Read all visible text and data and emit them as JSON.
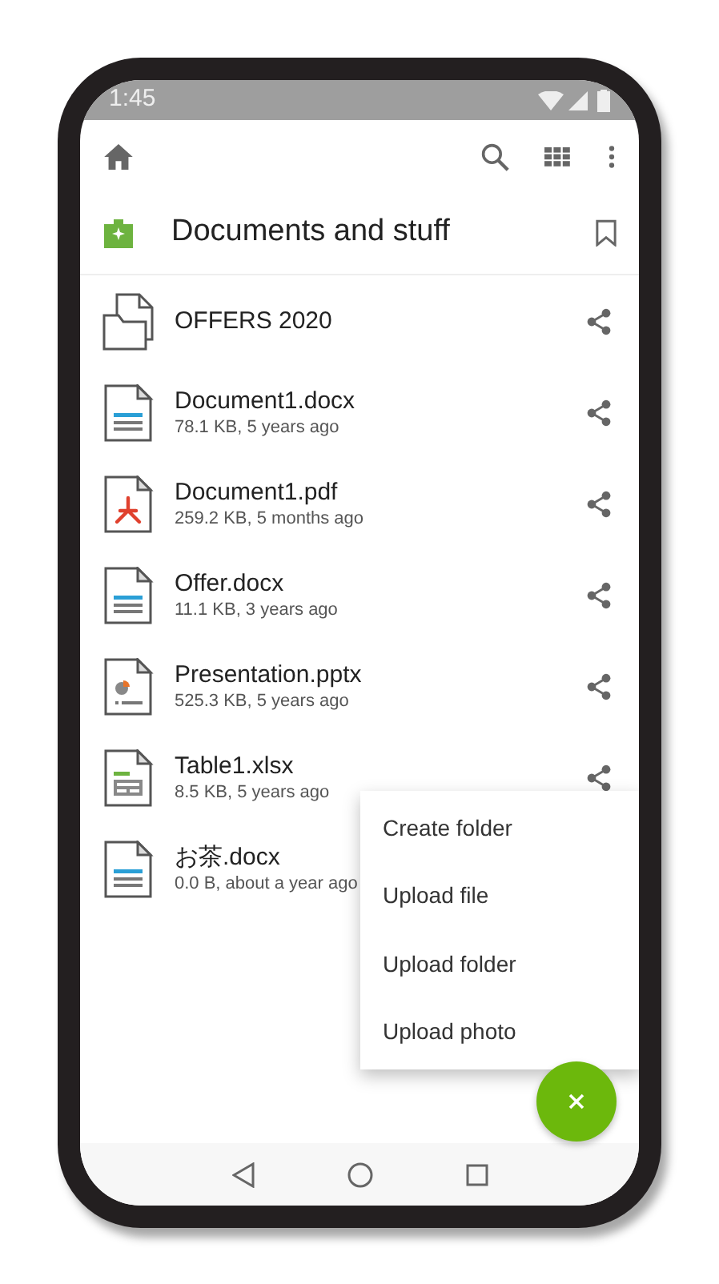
{
  "status_bar": {
    "time": "1:45"
  },
  "folder": {
    "title": "Documents and stuff"
  },
  "files": [
    {
      "kind": "folder",
      "name": "OFFERS 2020"
    },
    {
      "kind": "docx",
      "name": "Document1.docx",
      "meta": "78.1 KB, 5 years ago"
    },
    {
      "kind": "pdf",
      "name": "Document1.pdf",
      "meta": "259.2 KB, 5 months ago"
    },
    {
      "kind": "docx",
      "name": "Offer.docx",
      "meta": "11.1 KB, 3 years ago"
    },
    {
      "kind": "pptx",
      "name": "Presentation.pptx",
      "meta": "525.3 KB, 5 years ago"
    },
    {
      "kind": "xlsx",
      "name": "Table1.xlsx",
      "meta": "8.5 KB, 5 years ago"
    },
    {
      "kind": "docx",
      "name": "お茶.docx",
      "meta": "0.0 B, about a year ago"
    }
  ],
  "menu": [
    "Create folder",
    "Upload file",
    "Upload folder",
    "Upload photo"
  ]
}
